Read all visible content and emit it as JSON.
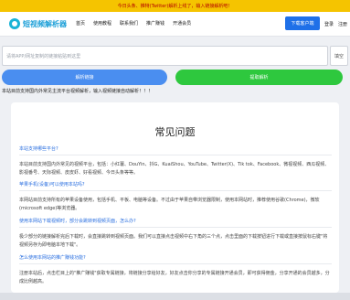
{
  "banner": {
    "text": "今日头条、推特(Twitter)解析上线了，输入链接解析吧！"
  },
  "nav": {
    "logo_text": "短视频解析器",
    "links": [
      "首页",
      "使用教程",
      "联系我们",
      "推广赚钱",
      "开通会员"
    ],
    "download_label": "下载客户端",
    "login_label": "登录",
    "register_label": "注册"
  },
  "search": {
    "placeholder": "请将APP/网址复制的链接粘贴到这里",
    "fill_label": "填空"
  },
  "actions": {
    "parse_label": "解析链接",
    "extract_label": "提取解析"
  },
  "notice": "本站目前支持国内外常见主流平台视频解析，输入视频链接自动解析！！！",
  "faq": {
    "title": "常见问题",
    "items": [
      {
        "q": "本站支持哪些平台?",
        "a": "本站目前支持国内外常见的视频平台，包括：小红薯、DouYin、抖G、KuaiShou、YouTube、Twitter(X)、Tik tok、Facebook、微视视频、西瓜视频、影视番号、天际视频、皮皮虾、好看视频、今日头条等等。"
      },
      {
        "q": "苹果手机(设备)可以使用本站吗?",
        "a": "本网站目前支持所有的苹果设备使用，包括手机、平板、电脑等设备。不过由于苹果自带浏览器限制，使用本网站时，推荐使用谷歌(Chrome)，微软(microsoft edge)等浏览器。"
      },
      {
        "q": "使用本网站下载视频时，部分会跳转到视频页面，怎么办?",
        "a": "极少部分的链接解析完后下载时，会直接跳转到视频页面。我们可以直接点击视频中右下角的三个点，点击里面的下载按钮进行下载或直接按鼠标右键\"将视频另存为即电脑本地下载\"。"
      },
      {
        "q": "怎么使用本网站的推广赚钱功能?",
        "a": "注册本站后，点击栏目上的\"推广赚钱\"获取专属链接，将链接分享给好友，好友点击你分享的专属链接开通会员，即可获得佣金，分享开通的会员越多，分成比例越高。"
      }
    ]
  }
}
